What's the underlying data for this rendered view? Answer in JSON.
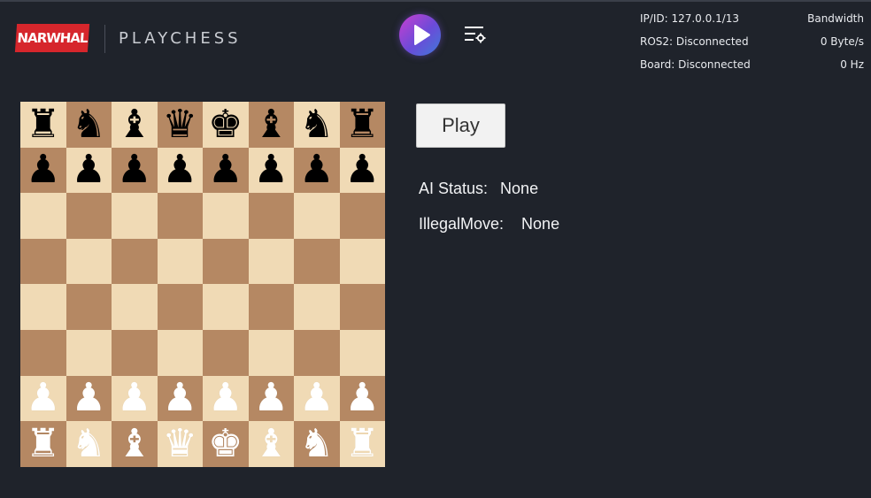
{
  "header": {
    "logo_text": "NARWHAL",
    "app_title": "PLAYCHESS",
    "play_icon": "play-icon",
    "settings_icon": "settings-list-icon"
  },
  "status": {
    "ip_label": "IP/ID: 127.0.0.1/13",
    "bandwidth_label": "Bandwidth",
    "ros2_label": "ROS2: Disconnected",
    "ros2_value": "0 Byte/s",
    "board_label": "Board: Disconnected",
    "board_value": "0 Hz"
  },
  "colors": {
    "background": "#1f232b",
    "logo_red": "#d6262c",
    "board_light": "#f0dab5",
    "board_dark": "#b58863"
  },
  "board": {
    "ranks": [
      [
        "bR",
        "bN",
        "bB",
        "bQ",
        "bK",
        "bB",
        "bN",
        "bR"
      ],
      [
        "bP",
        "bP",
        "bP",
        "bP",
        "bP",
        "bP",
        "bP",
        "bP"
      ],
      [
        "",
        "",
        "",
        "",
        "",
        "",
        "",
        ""
      ],
      [
        "",
        "",
        "",
        "",
        "",
        "",
        "",
        ""
      ],
      [
        "",
        "",
        "",
        "",
        "",
        "",
        "",
        ""
      ],
      [
        "",
        "",
        "",
        "",
        "",
        "",
        "",
        ""
      ],
      [
        "wP",
        "wP",
        "wP",
        "wP",
        "wP",
        "wP",
        "wP",
        "wP"
      ],
      [
        "wR",
        "wN",
        "wB",
        "wQ",
        "wK",
        "wB",
        "wN",
        "wR"
      ]
    ]
  },
  "controls": {
    "play_label": "Play",
    "ai_status_label": "AI Status:",
    "ai_status_value": "None",
    "illegal_move_label": "IllegalMove:",
    "illegal_move_value": "None"
  }
}
